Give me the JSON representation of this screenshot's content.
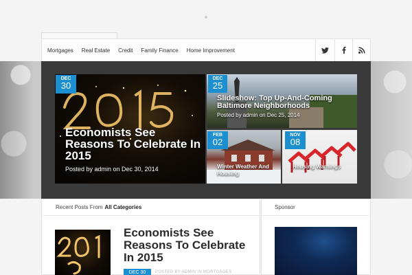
{
  "nav": {
    "items": [
      "Mortgages",
      "Real Estate",
      "Credit",
      "Family Finance",
      "Home Improvement"
    ],
    "social": [
      {
        "icon": "twitter-icon"
      },
      {
        "icon": "facebook-icon"
      },
      {
        "icon": "rss-icon"
      }
    ]
  },
  "featured": {
    "main": {
      "month": "DEC",
      "day": "30",
      "title": "Economists See Reasons To Celebrate In 2015",
      "meta": "Posted by admin on Dec 30, 2014"
    },
    "side_a": {
      "month": "DEC",
      "day": "25",
      "title": "Slideshow: Top Up-And-Coming Baltimore Neighborhoods",
      "meta": "Posted by admin on Dec 25, 2014"
    },
    "side_b": {
      "month": "FEB",
      "day": "02",
      "title": "Winter Weather And Housing"
    },
    "side_c": {
      "month": "NOV",
      "day": "08",
      "title": "Housing Warnings"
    }
  },
  "recent": {
    "heading_prefix": "Recent Posts From",
    "heading_bold": "All Categories",
    "post": {
      "title": "Economists See Reasons To Celebrate In 2015",
      "date": "DEC 30",
      "meta": "POSTED BY ADMIN IN MORTGAGES"
    }
  },
  "sponsor": {
    "heading": "Sponsor"
  },
  "colors": {
    "accent": "#1b8fcf",
    "featured_bg": "#3a3a3a"
  }
}
